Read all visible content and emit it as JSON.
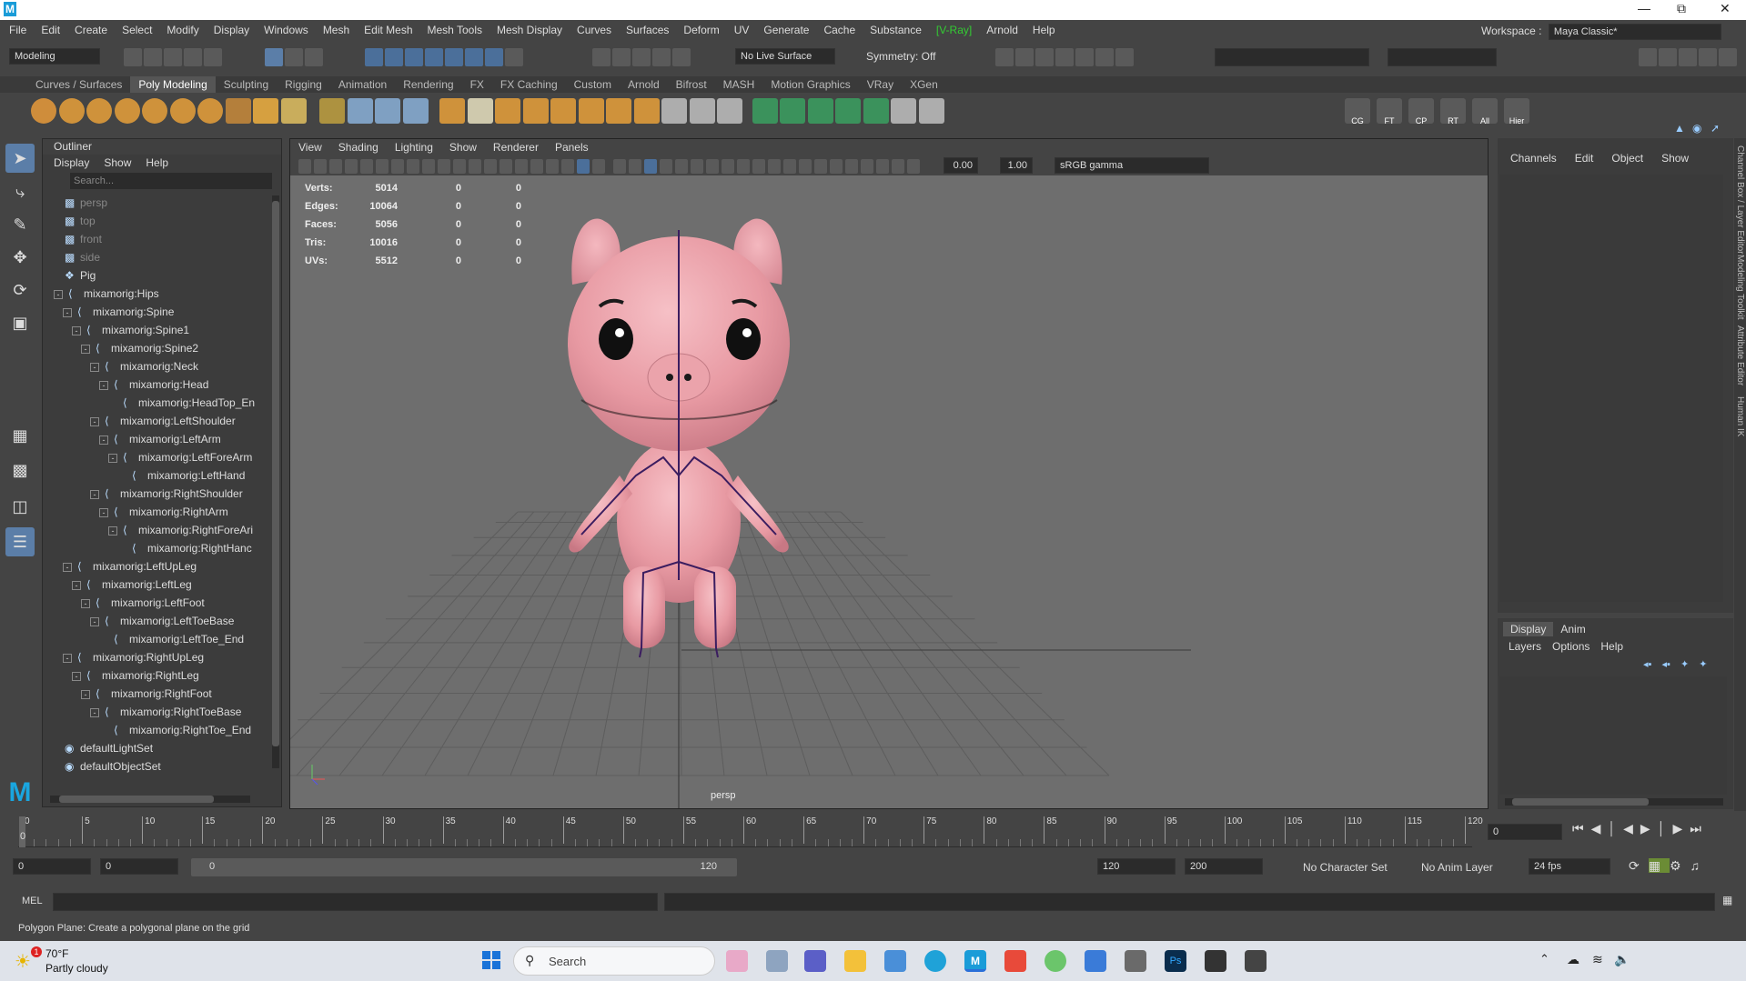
{
  "window": {
    "app_logo": "M"
  },
  "menubar": [
    "File",
    "Edit",
    "Create",
    "Select",
    "Modify",
    "Display",
    "Windows",
    "Mesh",
    "Edit Mesh",
    "Mesh Tools",
    "Mesh Display",
    "Curves",
    "Surfaces",
    "Deform",
    "UV",
    "Generate",
    "Cache",
    "Substance",
    "[V-Ray]",
    "Arnold",
    "Help"
  ],
  "workspace": {
    "label": "Workspace :",
    "value": "Maya Classic*"
  },
  "statusline": {
    "mode": "Modeling",
    "live_surface": "No Live Surface",
    "symmetry": "Symmetry: Off"
  },
  "shelf_tabs": [
    "Curves / Surfaces",
    "Poly Modeling",
    "Sculpting",
    "Rigging",
    "Animation",
    "Rendering",
    "FX",
    "FX Caching",
    "Custom",
    "Arnold",
    "Bifrost",
    "MASH",
    "Motion Graphics",
    "VRay",
    "XGen"
  ],
  "shelf_active": "Poly Modeling",
  "shelf_icons_right": [
    "CG",
    "FT",
    "CP",
    "RT",
    "All",
    "Hier"
  ],
  "outliner": {
    "title": "Outliner",
    "menu": [
      "Display",
      "Show",
      "Help"
    ],
    "search_placeholder": "Search...",
    "rows": [
      {
        "label": "persp",
        "indent": 0,
        "kind": "camera",
        "dim": true
      },
      {
        "label": "top",
        "indent": 0,
        "kind": "camera",
        "dim": true
      },
      {
        "label": "front",
        "indent": 0,
        "kind": "camera",
        "dim": true
      },
      {
        "label": "side",
        "indent": 0,
        "kind": "camera",
        "dim": true
      },
      {
        "label": "Pig",
        "indent": 0,
        "kind": "mesh"
      },
      {
        "label": "mixamorig:Hips",
        "indent": 0,
        "kind": "joint",
        "exp": true
      },
      {
        "label": "mixamorig:Spine",
        "indent": 1,
        "kind": "joint",
        "exp": true
      },
      {
        "label": "mixamorig:Spine1",
        "indent": 2,
        "kind": "joint",
        "exp": true
      },
      {
        "label": "mixamorig:Spine2",
        "indent": 3,
        "kind": "joint",
        "exp": true
      },
      {
        "label": "mixamorig:Neck",
        "indent": 4,
        "kind": "joint",
        "exp": true
      },
      {
        "label": "mixamorig:Head",
        "indent": 5,
        "kind": "joint",
        "exp": true
      },
      {
        "label": "mixamorig:HeadTop_En",
        "indent": 6,
        "kind": "joint"
      },
      {
        "label": "mixamorig:LeftShoulder",
        "indent": 4,
        "kind": "joint",
        "exp": true
      },
      {
        "label": "mixamorig:LeftArm",
        "indent": 5,
        "kind": "joint",
        "exp": true
      },
      {
        "label": "mixamorig:LeftForeArm",
        "indent": 6,
        "kind": "joint",
        "exp": true
      },
      {
        "label": "mixamorig:LeftHand",
        "indent": 7,
        "kind": "joint"
      },
      {
        "label": "mixamorig:RightShoulder",
        "indent": 4,
        "kind": "joint",
        "exp": true
      },
      {
        "label": "mixamorig:RightArm",
        "indent": 5,
        "kind": "joint",
        "exp": true
      },
      {
        "label": "mixamorig:RightForeAri",
        "indent": 6,
        "kind": "joint",
        "exp": true
      },
      {
        "label": "mixamorig:RightHanc",
        "indent": 7,
        "kind": "joint"
      },
      {
        "label": "mixamorig:LeftUpLeg",
        "indent": 1,
        "kind": "joint",
        "exp": true
      },
      {
        "label": "mixamorig:LeftLeg",
        "indent": 2,
        "kind": "joint",
        "exp": true
      },
      {
        "label": "mixamorig:LeftFoot",
        "indent": 3,
        "kind": "joint",
        "exp": true
      },
      {
        "label": "mixamorig:LeftToeBase",
        "indent": 4,
        "kind": "joint",
        "exp": true
      },
      {
        "label": "mixamorig:LeftToe_End",
        "indent": 5,
        "kind": "joint"
      },
      {
        "label": "mixamorig:RightUpLeg",
        "indent": 1,
        "kind": "joint",
        "exp": true
      },
      {
        "label": "mixamorig:RightLeg",
        "indent": 2,
        "kind": "joint",
        "exp": true
      },
      {
        "label": "mixamorig:RightFoot",
        "indent": 3,
        "kind": "joint",
        "exp": true
      },
      {
        "label": "mixamorig:RightToeBase",
        "indent": 4,
        "kind": "joint",
        "exp": true
      },
      {
        "label": "mixamorig:RightToe_End",
        "indent": 5,
        "kind": "joint"
      },
      {
        "label": "defaultLightSet",
        "indent": 0,
        "kind": "set"
      },
      {
        "label": "defaultObjectSet",
        "indent": 0,
        "kind": "set"
      }
    ]
  },
  "viewport": {
    "menu": [
      "View",
      "Shading",
      "Lighting",
      "Show",
      "Renderer",
      "Panels"
    ],
    "exposure": "0.00",
    "gamma": "1.00",
    "color_space": "sRGB gamma",
    "camera_label": "persp",
    "hud": [
      {
        "label": "Verts:",
        "a": "5014",
        "b": "0",
        "c": "0"
      },
      {
        "label": "Edges:",
        "a": "10064",
        "b": "0",
        "c": "0"
      },
      {
        "label": "Faces:",
        "a": "5056",
        "b": "0",
        "c": "0"
      },
      {
        "label": "Tris:",
        "a": "10016",
        "b": "0",
        "c": "0"
      },
      {
        "label": "UVs:",
        "a": "5512",
        "b": "0",
        "c": "0"
      }
    ]
  },
  "channelbox": {
    "menu": [
      "Channels",
      "Edit",
      "Object",
      "Show"
    ],
    "side_tabs": [
      "Channel Box / Layer Editor",
      "Modeling Toolkit",
      "Attribute Editor",
      "Human IK"
    ]
  },
  "layer_editor": {
    "tabs": [
      "Display",
      "Anim"
    ],
    "menu": [
      "Layers",
      "Options",
      "Help"
    ]
  },
  "timeline": {
    "ticks": [
      "0",
      "5",
      "10",
      "15",
      "20",
      "25",
      "30",
      "35",
      "40",
      "45",
      "50",
      "55",
      "60",
      "65",
      "70",
      "75",
      "80",
      "85",
      "90",
      "95",
      "100",
      "105",
      "110",
      "115",
      "120"
    ],
    "current_frame": "0",
    "current_marker": "0"
  },
  "range": {
    "start": "0",
    "range_start": "0",
    "slider_start": "0",
    "slider_end": "120",
    "range_end": "120",
    "end": "200",
    "character_set": "No Character Set",
    "anim_layer": "No Anim Layer",
    "fps": "24 fps"
  },
  "mel": {
    "label": "MEL"
  },
  "helpline": "Polygon Plane: Create a polygonal plane on the grid",
  "taskbar": {
    "weather_temp": "70°F",
    "weather_desc": "Partly cloudy",
    "search_placeholder": "Search",
    "badge": "1"
  }
}
